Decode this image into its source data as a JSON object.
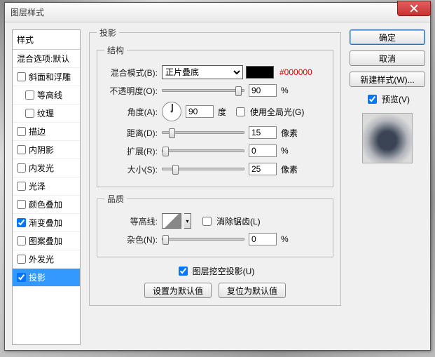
{
  "window": {
    "title": "图层样式"
  },
  "close_icon": "×",
  "stylelist": {
    "header": "样式",
    "items": [
      {
        "label": "混合选项:默认",
        "checked": null
      },
      {
        "label": "斜面和浮雕",
        "checked": false
      },
      {
        "label": "等高线",
        "checked": false,
        "sub": true
      },
      {
        "label": "纹理",
        "checked": false,
        "sub": true
      },
      {
        "label": "描边",
        "checked": false
      },
      {
        "label": "内阴影",
        "checked": false
      },
      {
        "label": "内发光",
        "checked": false
      },
      {
        "label": "光泽",
        "checked": false
      },
      {
        "label": "颜色叠加",
        "checked": false
      },
      {
        "label": "渐变叠加",
        "checked": true
      },
      {
        "label": "图案叠加",
        "checked": false
      },
      {
        "label": "外发光",
        "checked": false
      },
      {
        "label": "投影",
        "checked": true,
        "selected": true
      }
    ]
  },
  "panel": {
    "title": "投影",
    "group_struct": "结构",
    "group_quality": "品质",
    "blend_label": "混合模式(B):",
    "blend_value": "正片叠底",
    "swatch_hex": "#000000",
    "opacity_label": "不透明度(O):",
    "opacity_value": "90",
    "pct": "%",
    "angle_label": "角度(A):",
    "angle_value": "90",
    "degree": "度",
    "global_label": "使用全局光(G)",
    "global_checked": false,
    "distance_label": "距离(D):",
    "distance_value": "15",
    "px": "像素",
    "spread_label": "扩展(R):",
    "spread_value": "0",
    "size_label": "大小(S):",
    "size_value": "25",
    "contour_label": "等高线:",
    "antialias_label": "消除锯齿(L)",
    "antialias_checked": false,
    "noise_label": "杂色(N):",
    "noise_value": "0",
    "knockout_label": "图层挖空投影(U)",
    "knockout_checked": true,
    "btn_setdefault": "设置为默认值",
    "btn_resetdefault": "复位为默认值"
  },
  "right": {
    "ok": "确定",
    "cancel": "取消",
    "newstyle": "新建样式(W)...",
    "preview_label": "预览(V)",
    "preview_checked": true
  }
}
